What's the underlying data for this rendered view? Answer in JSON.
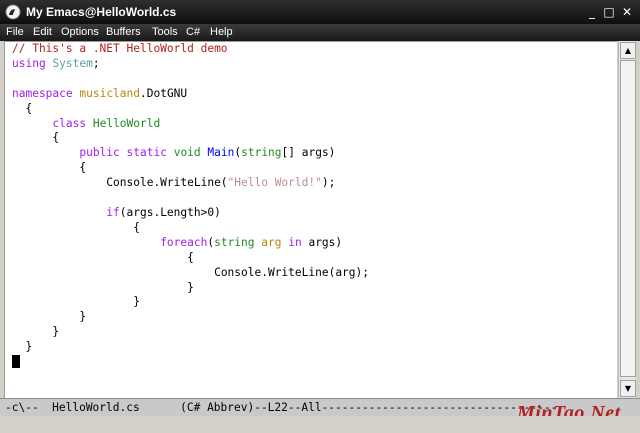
{
  "window": {
    "title": "My Emacs@HelloWorld.cs",
    "minimize": "_",
    "maximize": "□",
    "close": "✕",
    "icon": "emacs-gnu-icon"
  },
  "menu": [
    {
      "label": "File"
    },
    {
      "label": "Edit"
    },
    {
      "label": "Options"
    },
    {
      "label": "Buffers"
    },
    {
      "label": "Tools"
    },
    {
      "label": "C#"
    },
    {
      "label": "Help"
    }
  ],
  "code": {
    "comment": "// This's a .NET HelloWorld demo",
    "using_kw": "using",
    "using_ns": "System",
    "namespace_kw": "namespace",
    "namespace_name": "musicland",
    "namespace_rest": ".DotGNU",
    "class_kw": "class",
    "class_name": "HelloWorld",
    "public_kw": "public",
    "static_kw": "static",
    "void_kw": "void",
    "main_name": "Main",
    "string_type": "string",
    "args_rest": "[] args)",
    "console_call": "Console.WriteLine(",
    "hello_str": "\"Hello World!\"",
    "call_end": ");",
    "if_kw": "if",
    "if_cond": "(args.Length>0)",
    "foreach_kw": "foreach",
    "arg_var": "arg",
    "in_kw": "in",
    "foreach_rest": " args)",
    "console_arg": "Console.WriteLine(arg);"
  },
  "modeline": {
    "text": "-c\\--  HelloWorld.cs      (C# Abbrev)--L22--All-----------------------------------"
  },
  "watermark": {
    "text": "MinTao.Net"
  },
  "scrollbar": {
    "up": "▲",
    "down": "▼"
  },
  "colors": {
    "comment": "#b22222",
    "keyword": "#a020f0",
    "type": "#228b22",
    "string": "#bc8f8f",
    "namespace": "#b8860b",
    "cyan": "#5f9ea0",
    "function": "#0000ff"
  }
}
